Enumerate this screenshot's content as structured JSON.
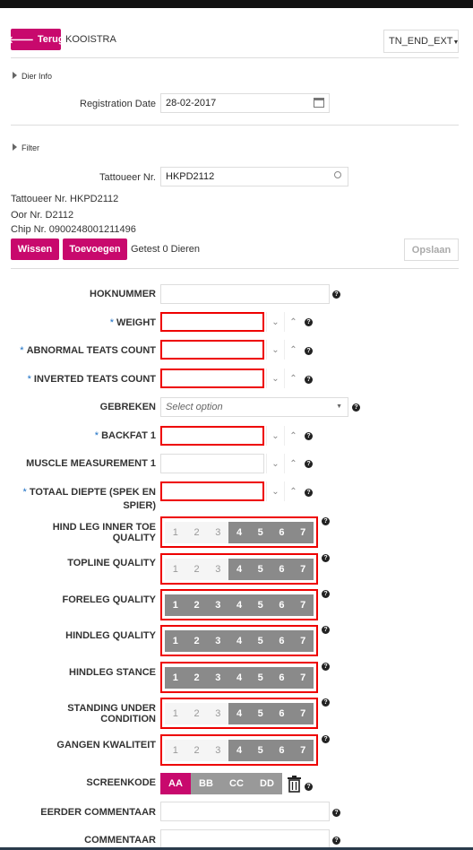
{
  "header": {
    "back_label": "Terug",
    "farm_name": "KOOISTRA",
    "env_select": "TN_END_EXT"
  },
  "dier_info": {
    "section_label": "Dier Info",
    "registration_date_label": "Registration Date",
    "registration_date_value": "28-02-2017"
  },
  "filter": {
    "section_label": "Filter",
    "tattoo_label": "Tattoueer Nr.",
    "tattoo_value": "HKPD2112",
    "info_tattoo": "Tattoueer Nr. HKPD2112",
    "info_oor": "Oor Nr. D2112",
    "info_chip": "Chip Nr. 0900248001211496"
  },
  "actions": {
    "wissen": "Wissen",
    "toevoegen": "Toevoegen",
    "getest": "Getest 0 Dieren",
    "opslaan": "Opslaan"
  },
  "fields": {
    "hoknummer": "HOKNUMMER",
    "weight": "WEIGHT",
    "abnormal_teats": "ABNORMAL TEATS COUNT",
    "inverted_teats": "INVERTED TEATS COUNT",
    "gebreken": "GEBREKEN",
    "gebreken_placeholder": "Select option",
    "backfat": "BACKFAT 1",
    "muscle": "MUSCLE MEASUREMENT 1",
    "totaal_diepte": "TOTAAL DIEPTE (SPEK EN SPIER)",
    "required_mark": "*",
    "help": "?"
  },
  "scales": {
    "numbers": [
      "1",
      "2",
      "3",
      "4",
      "5",
      "6",
      "7"
    ],
    "hind_leg_toe": "HIND LEG INNER TOE QUALITY",
    "topline": "TOPLINE QUALITY",
    "foreleg": "FORELEG QUALITY",
    "hindleg_quality": "HINDLEG QUALITY",
    "hindleg_stance": "HINDLEG STANCE",
    "standing_under": "STANDING UNDER CONDITION",
    "gangen": "GANGEN KWALITEIT"
  },
  "screenkode": {
    "label": "SCREENKODE",
    "options": [
      "AA",
      "BB",
      "CC",
      "DD"
    ],
    "selected": "AA"
  },
  "comments": {
    "eerder": "EERDER COMMENTAAR",
    "commentaar": "COMMENTAAR"
  }
}
